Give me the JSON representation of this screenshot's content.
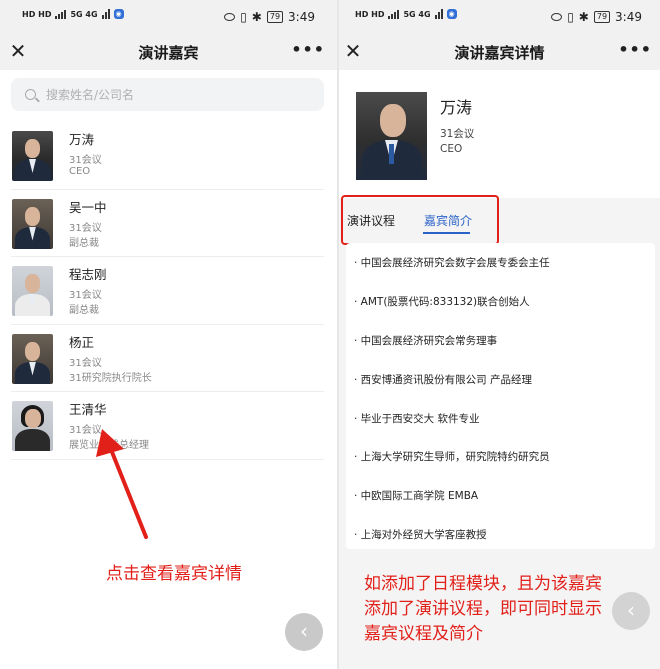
{
  "status_bar": {
    "left_indicators": "HD HD",
    "network": "5G 4G",
    "battery": "79",
    "time": "3:49"
  },
  "left_screen": {
    "title": "演讲嘉宾",
    "search_placeholder": "搜索姓名/公司名",
    "speakers": [
      {
        "name": "万涛",
        "conference": "31会议",
        "title": "CEO"
      },
      {
        "name": "吴一中",
        "conference": "31会议",
        "title": "副总裁"
      },
      {
        "name": "程志刚",
        "conference": "31会议",
        "title": "副总裁"
      },
      {
        "name": "杨正",
        "conference": "31会议",
        "title": "31研究院执行院长"
      },
      {
        "name": "王清华",
        "conference": "31会议",
        "title": "展览业务线总经理"
      }
    ],
    "annotation": "点击查看嘉宾详情"
  },
  "right_screen": {
    "title": "演讲嘉宾详情",
    "profile": {
      "name": "万涛",
      "conference": "31会议",
      "title": "CEO"
    },
    "tabs": {
      "agenda": "演讲议程",
      "bio": "嘉宾简介"
    },
    "bio_items": [
      "· 中国会展经济研究会数字会展专委会主任",
      "· AMT(股票代码:833132)联合创始人",
      "· 中国会展经济研究会常务理事",
      "· 西安博通资讯股份有限公司 产品经理",
      "· 毕业于西安交大 软件专业",
      "· 上海大学研究生导师，研究院特约研究员",
      "· 中欧国际工商学院 EMBA",
      "· 上海对外经贸大学客座教授"
    ],
    "annotation_lines": [
      "如添加了日程模块，且为该嘉宾",
      "添加了演讲议程，即可同时显示",
      "嘉宾议程及简介"
    ]
  },
  "icons": {
    "close": "close-icon",
    "more": "more-icon",
    "search": "search-icon",
    "back": "back-icon"
  },
  "colors": {
    "accent_blue": "#2a62c9",
    "annotation_red": "#e2201a"
  }
}
